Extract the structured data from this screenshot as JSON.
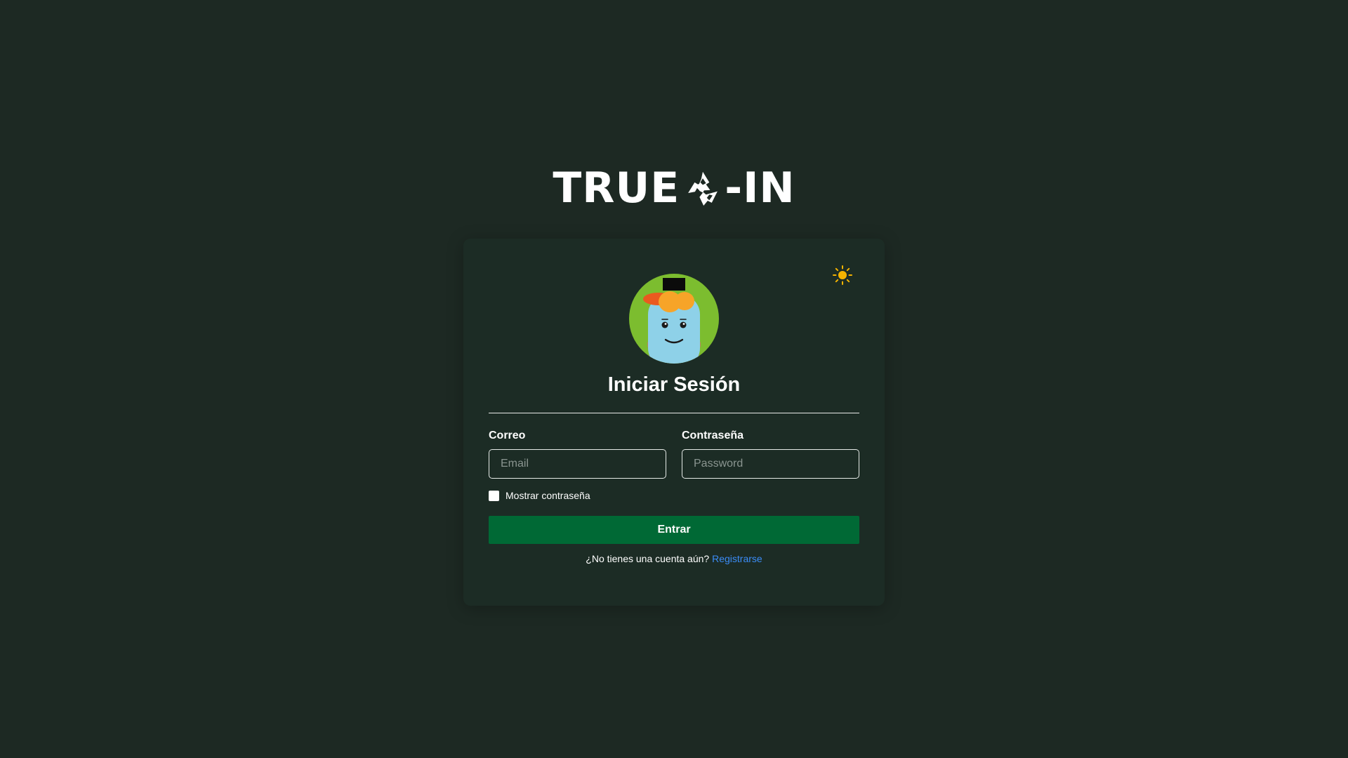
{
  "brand": {
    "name_before": "TRUE",
    "name_after": "-IN",
    "logo_icon": "recycle-icon"
  },
  "theme_toggle": {
    "icon": "sun-icon",
    "color": "#f5b400"
  },
  "login": {
    "title": "Iniciar Sesión",
    "email_label": "Correo",
    "email_placeholder": "Email",
    "email_value": "",
    "password_label": "Contraseña",
    "password_placeholder": "Password",
    "password_value": "",
    "show_password_label": "Mostrar contraseña",
    "show_password_checked": false,
    "submit_label": "Entrar",
    "no_account_text": "¿No tienes una cuenta aún?",
    "register_link": "Registrarse"
  },
  "colors": {
    "background": "#1d2923",
    "card": "#1c2c25",
    "primary_button": "#006935",
    "link": "#3b8cf6"
  }
}
